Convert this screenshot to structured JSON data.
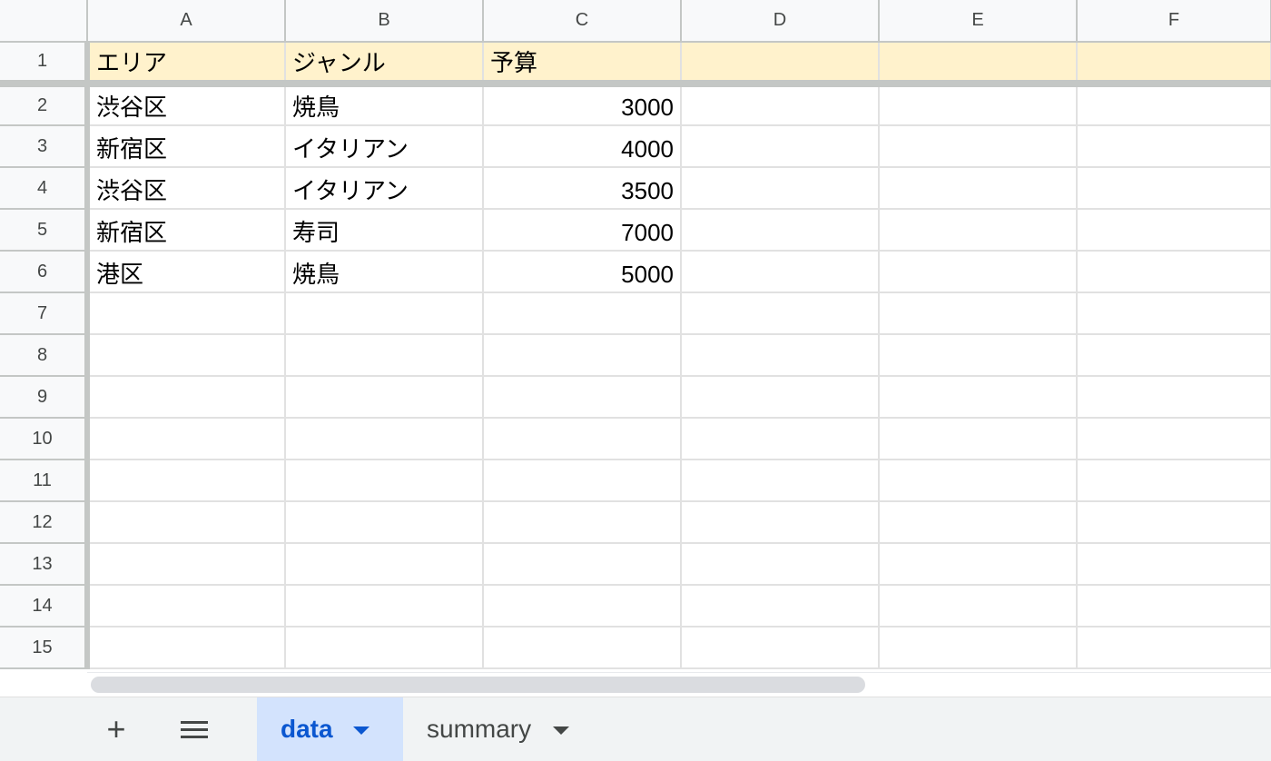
{
  "columns": [
    "A",
    "B",
    "C",
    "D",
    "E",
    "F"
  ],
  "rows": [
    {
      "num": "1",
      "cells": [
        "エリア",
        "ジャンル",
        "予算",
        "",
        "",
        ""
      ]
    },
    {
      "num": "2",
      "cells": [
        "渋谷区",
        "焼鳥",
        "3000",
        "",
        "",
        ""
      ]
    },
    {
      "num": "3",
      "cells": [
        "新宿区",
        "イタリアン",
        "4000",
        "",
        "",
        ""
      ]
    },
    {
      "num": "4",
      "cells": [
        "渋谷区",
        "イタリアン",
        "3500",
        "",
        "",
        ""
      ]
    },
    {
      "num": "5",
      "cells": [
        "新宿区",
        "寿司",
        "7000",
        "",
        "",
        ""
      ]
    },
    {
      "num": "6",
      "cells": [
        "港区",
        "焼鳥",
        "5000",
        "",
        "",
        ""
      ]
    },
    {
      "num": "7",
      "cells": [
        "",
        "",
        "",
        "",
        "",
        ""
      ]
    },
    {
      "num": "8",
      "cells": [
        "",
        "",
        "",
        "",
        "",
        ""
      ]
    },
    {
      "num": "9",
      "cells": [
        "",
        "",
        "",
        "",
        "",
        ""
      ]
    },
    {
      "num": "10",
      "cells": [
        "",
        "",
        "",
        "",
        "",
        ""
      ]
    },
    {
      "num": "11",
      "cells": [
        "",
        "",
        "",
        "",
        "",
        ""
      ]
    },
    {
      "num": "12",
      "cells": [
        "",
        "",
        "",
        "",
        "",
        ""
      ]
    },
    {
      "num": "13",
      "cells": [
        "",
        "",
        "",
        "",
        "",
        ""
      ]
    },
    {
      "num": "14",
      "cells": [
        "",
        "",
        "",
        "",
        "",
        ""
      ]
    },
    {
      "num": "15",
      "cells": [
        "",
        "",
        "",
        "",
        "",
        ""
      ]
    }
  ],
  "header_row_fill": "#fff2cc",
  "tabs": {
    "add_label": "+",
    "sheets": [
      {
        "label": "data",
        "active": true
      },
      {
        "label": "summary",
        "active": false
      }
    ]
  },
  "colors": {
    "active_tab_bg": "#d3e3fd",
    "active_tab_text": "#0b57d0"
  },
  "icons": [
    "add-sheet-icon",
    "all-sheets-menu-icon",
    "dropdown-caret-icon"
  ]
}
